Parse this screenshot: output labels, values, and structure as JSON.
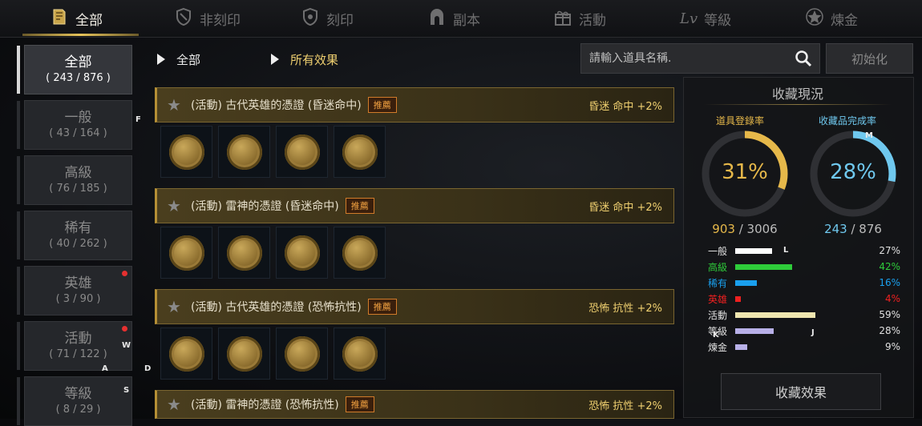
{
  "tabs": [
    {
      "label": "全部",
      "icon": "book-icon"
    },
    {
      "label": "非刻印",
      "icon": "shield-lock-icon"
    },
    {
      "label": "刻印",
      "icon": "shield-engrave-icon"
    },
    {
      "label": "副本",
      "icon": "dungeon-gate-icon"
    },
    {
      "label": "活動",
      "icon": "gift-icon"
    },
    {
      "label": "等級",
      "icon": "level-icon"
    },
    {
      "label": "煉金",
      "icon": "alchemy-star-icon"
    }
  ],
  "level_icon_text": "Lv",
  "categories": [
    {
      "label": "全部",
      "count": "( 243 / 876 )",
      "dot": false
    },
    {
      "label": "一般",
      "count": "( 43 / 164 )",
      "dot": false
    },
    {
      "label": "高級",
      "count": "( 76 / 185 )",
      "dot": false
    },
    {
      "label": "稀有",
      "count": "( 40 / 262 )",
      "dot": false
    },
    {
      "label": "英雄",
      "count": "( 3 / 90 )",
      "dot": true
    },
    {
      "label": "活動",
      "count": "( 71 / 122 )",
      "dot": true
    },
    {
      "label": "等級",
      "count": "( 8 / 29 )",
      "dot": false
    }
  ],
  "filters": {
    "category": "全部",
    "effect": "所有效果"
  },
  "search": {
    "placeholder": "請輸入道具名稱.",
    "value": ""
  },
  "reset_label": "初始化",
  "entries": [
    {
      "name": "(活動) 古代英雄的憑證 (昏迷命中)",
      "badge": "推薦",
      "effect": "昏迷 命中 +2%"
    },
    {
      "name": "(活動) 雷神的憑證 (昏迷命中)",
      "badge": "推薦",
      "effect": "昏迷 命中 +2%"
    },
    {
      "name": "(活動) 古代英雄的憑證 (恐怖抗性)",
      "badge": "推薦",
      "effect": "恐怖 抗性 +2%"
    },
    {
      "name": "(活動) 雷神的憑證 (恐怖抗性)",
      "badge": "推薦",
      "effect": "恐怖 抗性 +2%"
    }
  ],
  "panel": {
    "title": "收藏現況",
    "ring1": {
      "label": "道具登錄率",
      "percent": "31%",
      "value": 0.31,
      "count_current": "903",
      "count_total": " / 3006",
      "color": "#e6b84a"
    },
    "ring2": {
      "label": "收藏品完成率",
      "percent": "28%",
      "value": 0.28,
      "count_current": "243",
      "count_total": " / 876",
      "color": "#6fc8ee"
    },
    "stats": [
      {
        "name": "一般",
        "percent": "27%",
        "value": 0.27,
        "color": "#ffffff",
        "name_color": "#e0e0e0"
      },
      {
        "name": "高級",
        "percent": "42%",
        "value": 0.42,
        "color": "#2ecc3a",
        "name_color": "#2ecc3a"
      },
      {
        "name": "稀有",
        "percent": "16%",
        "value": 0.16,
        "color": "#1aa0ee",
        "name_color": "#1aa0ee"
      },
      {
        "name": "英雄",
        "percent": "4%",
        "value": 0.04,
        "color": "#ee2020",
        "name_color": "#ee2020"
      },
      {
        "name": "活動",
        "percent": "59%",
        "value": 0.59,
        "color": "#efe6b0",
        "name_color": "#e0e0e0"
      },
      {
        "name": "等級",
        "percent": "28%",
        "value": 0.28,
        "color": "#b8b0e8",
        "name_color": "#e0e0e0"
      },
      {
        "name": "煉金",
        "percent": "9%",
        "value": 0.09,
        "color": "#b8b0e8",
        "name_color": "#e0e0e0"
      }
    ],
    "effect_button": "收藏效果"
  },
  "overlay_letters": [
    "F",
    "W",
    "A",
    "D",
    "S",
    "M",
    "L",
    "K",
    "J"
  ]
}
